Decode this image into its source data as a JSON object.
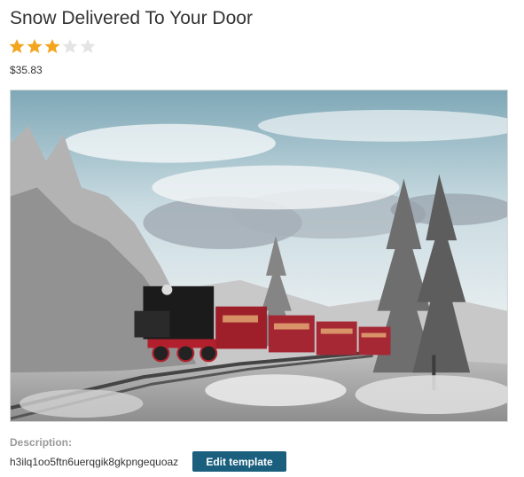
{
  "product": {
    "title": "Snow Delivered To Your Door",
    "rating": 3,
    "rating_max": 5,
    "price": "$35.83",
    "image_icon": "snowy-steam-train-photo"
  },
  "description": {
    "label": "Description:",
    "value": "h3ilq1oo5ftn6uerqgik8gkpngequoaz",
    "edit_button_label": "Edit template"
  },
  "colors": {
    "star_filled": "#f3a51d",
    "star_empty": "#e4e4e4",
    "button_bg": "#1a5f7e",
    "label_gray": "#9a9a9a"
  }
}
